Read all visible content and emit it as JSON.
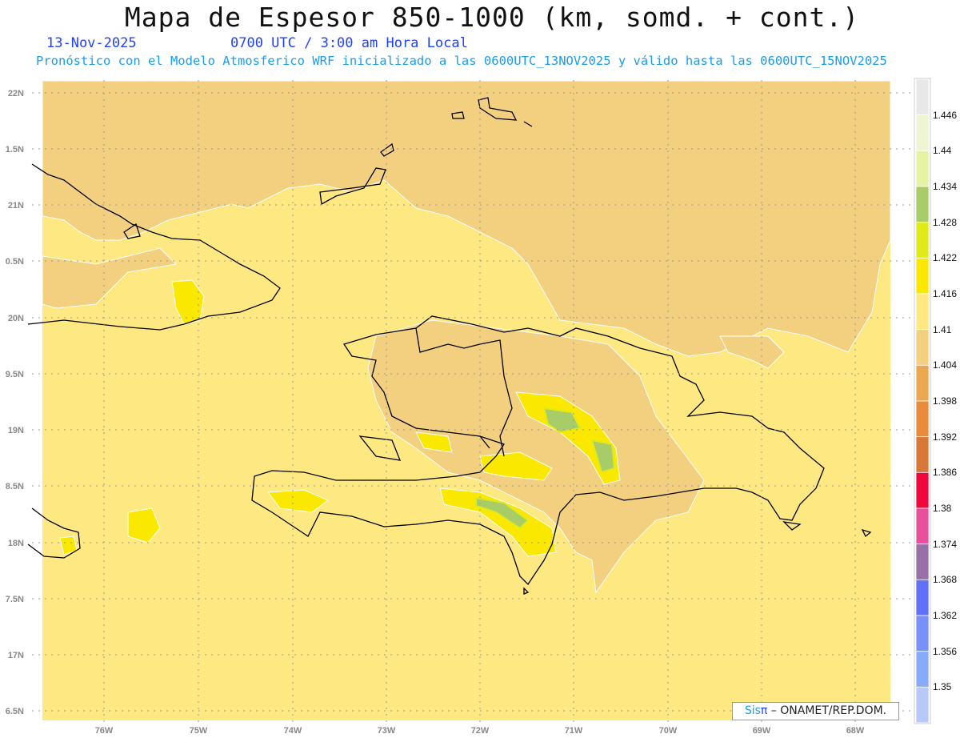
{
  "title": "Mapa de Espesor 850-1000 (km, somd. + cont.)",
  "date": "13-Nov-2025",
  "time": "0700 UTC / 3:00 am Hora Local",
  "forecast_note": "Pronóstico con el Modelo Atmosferico WRF inicializado a las 0600UTC_13NOV2025 y válido hasta las  0600UTC_15NOV2025",
  "lat_labels": [
    "22N",
    "1.5N",
    "21N",
    "0.5N",
    "20N",
    "9.5N",
    "19N",
    "8.5N",
    "18N",
    "7.5N",
    "17N",
    "6.5N"
  ],
  "lon_labels": [
    "76W",
    "75W",
    "74W",
    "73W",
    "72W",
    "71W",
    "70W",
    "69W",
    "68W"
  ],
  "colorbar": {
    "labels": [
      "1.446",
      "1.44",
      "1.434",
      "1.428",
      "1.422",
      "1.416",
      "1.41",
      "1.404",
      "1.398",
      "1.392",
      "1.386",
      "1.38",
      "1.374",
      "1.368",
      "1.362",
      "1.356",
      "1.35"
    ],
    "colors": [
      "#e8e8e8",
      "#eef5d2",
      "#e6f3a2",
      "#a8cc68",
      "#e0ea18",
      "#fae800",
      "#fde882",
      "#f2d080",
      "#eca850",
      "#e88c3c",
      "#d87838",
      "#f0083c",
      "#e8509c",
      "#9870a8",
      "#6070f8",
      "#7890f8",
      "#88aaf8",
      "#b8c8f8"
    ]
  },
  "credit": {
    "sis": "Sis",
    "pi": "π",
    "org": " – ONAMET/REP.DOM."
  }
}
